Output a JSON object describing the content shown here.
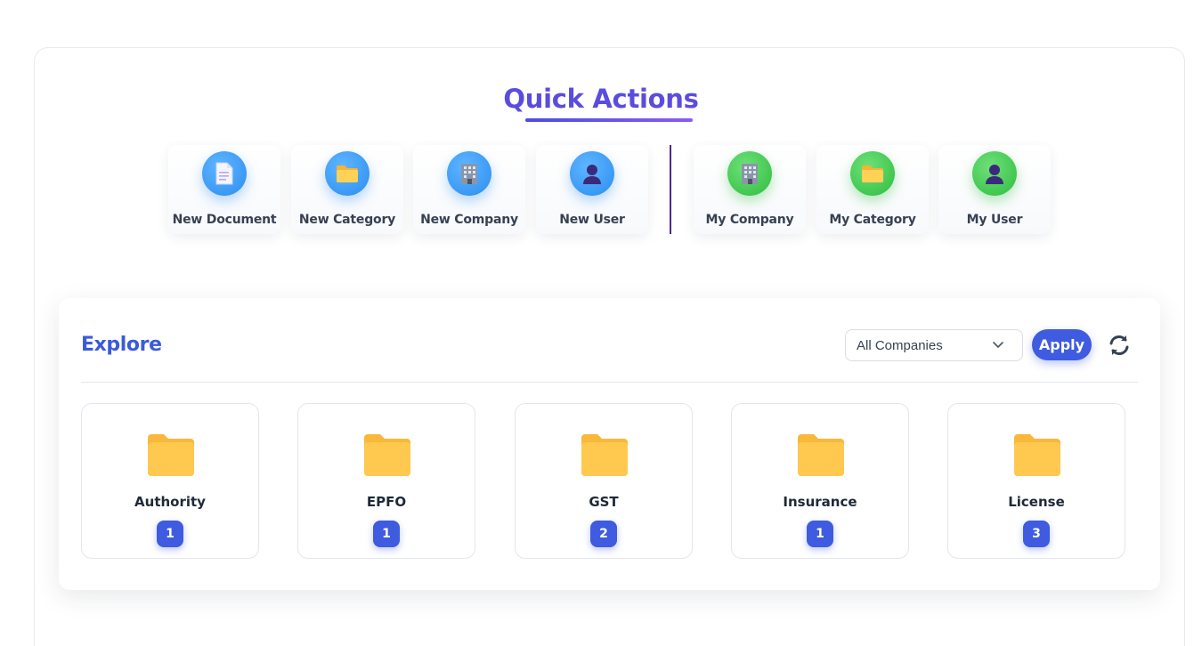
{
  "quick_actions": {
    "title": "Quick Actions",
    "items": [
      {
        "label": "New Document",
        "icon": "document-icon",
        "color": "#2b8df0"
      },
      {
        "label": "New Category",
        "icon": "folder-icon",
        "color": "#2b8df0"
      },
      {
        "label": "New Company",
        "icon": "building-icon",
        "color": "#2b8df0"
      },
      {
        "label": "New User",
        "icon": "user-icon",
        "color": "#2b8df0"
      },
      {
        "label": "My Company",
        "icon": "building-icon",
        "color": "#2ebd3e"
      },
      {
        "label": "My Category",
        "icon": "folder-icon",
        "color": "#2ebd3e"
      },
      {
        "label": "My User",
        "icon": "user-icon",
        "color": "#2ebd3e"
      }
    ]
  },
  "explore": {
    "title": "Explore",
    "company_filter": {
      "selected": "All Companies",
      "icon": "chevron-down-icon"
    },
    "apply_label": "Apply",
    "refresh_icon": "refresh-icon",
    "categories": [
      {
        "name": "Authority",
        "count": "1",
        "icon": "folder-icon"
      },
      {
        "name": "EPFO",
        "count": "1",
        "icon": "folder-icon"
      },
      {
        "name": "GST",
        "count": "2",
        "icon": "folder-icon"
      },
      {
        "name": "Insurance",
        "count": "1",
        "icon": "folder-icon"
      },
      {
        "name": "License",
        "count": "3",
        "icon": "folder-icon"
      }
    ]
  },
  "colors": {
    "accent": "#3f5be0",
    "title_purple": "#5b4ce0",
    "folder": "#ffc04a"
  }
}
